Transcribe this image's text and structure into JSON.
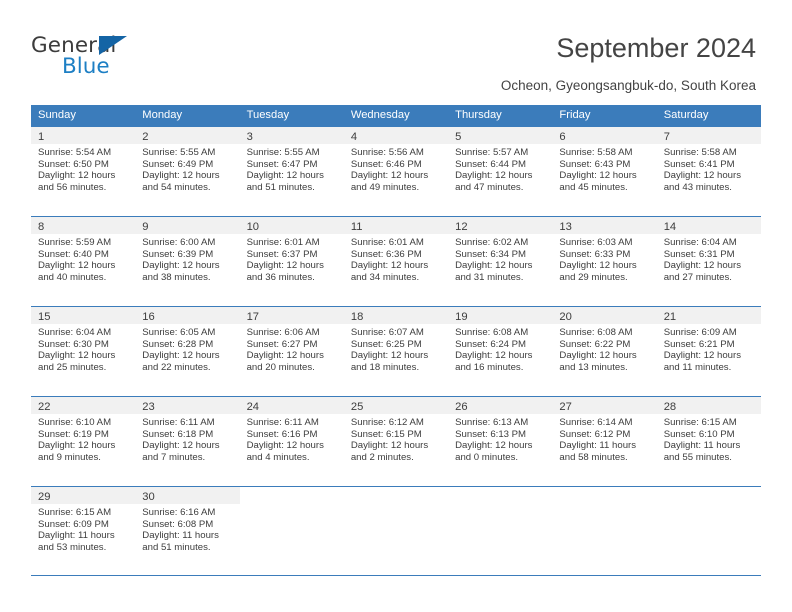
{
  "brand": {
    "name_top": "General",
    "name_bottom": "Blue",
    "triangle_color": "#1464a5",
    "blue_color": "#1d7fc4"
  },
  "header": {
    "title": "September 2024",
    "subtitle": "Ocheon, Gyeongsangbuk-do, South Korea"
  },
  "theme": {
    "header_blue": "#3b7cbb",
    "daynum_band": "#f1f1f1",
    "text": "#3d3d3d"
  },
  "weekdays": [
    "Sunday",
    "Monday",
    "Tuesday",
    "Wednesday",
    "Thursday",
    "Friday",
    "Saturday"
  ],
  "labels": {
    "sunrise_prefix": "Sunrise: ",
    "sunset_prefix": "Sunset: ",
    "daylight_prefix": "Daylight: "
  },
  "weeks": [
    [
      {
        "day": "1",
        "sunrise": "Sunrise: 5:54 AM",
        "sunset": "Sunset: 6:50 PM",
        "daylight_1": "Daylight: 12 hours",
        "daylight_2": "and 56 minutes."
      },
      {
        "day": "2",
        "sunrise": "Sunrise: 5:55 AM",
        "sunset": "Sunset: 6:49 PM",
        "daylight_1": "Daylight: 12 hours",
        "daylight_2": "and 54 minutes."
      },
      {
        "day": "3",
        "sunrise": "Sunrise: 5:55 AM",
        "sunset": "Sunset: 6:47 PM",
        "daylight_1": "Daylight: 12 hours",
        "daylight_2": "and 51 minutes."
      },
      {
        "day": "4",
        "sunrise": "Sunrise: 5:56 AM",
        "sunset": "Sunset: 6:46 PM",
        "daylight_1": "Daylight: 12 hours",
        "daylight_2": "and 49 minutes."
      },
      {
        "day": "5",
        "sunrise": "Sunrise: 5:57 AM",
        "sunset": "Sunset: 6:44 PM",
        "daylight_1": "Daylight: 12 hours",
        "daylight_2": "and 47 minutes."
      },
      {
        "day": "6",
        "sunrise": "Sunrise: 5:58 AM",
        "sunset": "Sunset: 6:43 PM",
        "daylight_1": "Daylight: 12 hours",
        "daylight_2": "and 45 minutes."
      },
      {
        "day": "7",
        "sunrise": "Sunrise: 5:58 AM",
        "sunset": "Sunset: 6:41 PM",
        "daylight_1": "Daylight: 12 hours",
        "daylight_2": "and 43 minutes."
      }
    ],
    [
      {
        "day": "8",
        "sunrise": "Sunrise: 5:59 AM",
        "sunset": "Sunset: 6:40 PM",
        "daylight_1": "Daylight: 12 hours",
        "daylight_2": "and 40 minutes."
      },
      {
        "day": "9",
        "sunrise": "Sunrise: 6:00 AM",
        "sunset": "Sunset: 6:39 PM",
        "daylight_1": "Daylight: 12 hours",
        "daylight_2": "and 38 minutes."
      },
      {
        "day": "10",
        "sunrise": "Sunrise: 6:01 AM",
        "sunset": "Sunset: 6:37 PM",
        "daylight_1": "Daylight: 12 hours",
        "daylight_2": "and 36 minutes."
      },
      {
        "day": "11",
        "sunrise": "Sunrise: 6:01 AM",
        "sunset": "Sunset: 6:36 PM",
        "daylight_1": "Daylight: 12 hours",
        "daylight_2": "and 34 minutes."
      },
      {
        "day": "12",
        "sunrise": "Sunrise: 6:02 AM",
        "sunset": "Sunset: 6:34 PM",
        "daylight_1": "Daylight: 12 hours",
        "daylight_2": "and 31 minutes."
      },
      {
        "day": "13",
        "sunrise": "Sunrise: 6:03 AM",
        "sunset": "Sunset: 6:33 PM",
        "daylight_1": "Daylight: 12 hours",
        "daylight_2": "and 29 minutes."
      },
      {
        "day": "14",
        "sunrise": "Sunrise: 6:04 AM",
        "sunset": "Sunset: 6:31 PM",
        "daylight_1": "Daylight: 12 hours",
        "daylight_2": "and 27 minutes."
      }
    ],
    [
      {
        "day": "15",
        "sunrise": "Sunrise: 6:04 AM",
        "sunset": "Sunset: 6:30 PM",
        "daylight_1": "Daylight: 12 hours",
        "daylight_2": "and 25 minutes."
      },
      {
        "day": "16",
        "sunrise": "Sunrise: 6:05 AM",
        "sunset": "Sunset: 6:28 PM",
        "daylight_1": "Daylight: 12 hours",
        "daylight_2": "and 22 minutes."
      },
      {
        "day": "17",
        "sunrise": "Sunrise: 6:06 AM",
        "sunset": "Sunset: 6:27 PM",
        "daylight_1": "Daylight: 12 hours",
        "daylight_2": "and 20 minutes."
      },
      {
        "day": "18",
        "sunrise": "Sunrise: 6:07 AM",
        "sunset": "Sunset: 6:25 PM",
        "daylight_1": "Daylight: 12 hours",
        "daylight_2": "and 18 minutes."
      },
      {
        "day": "19",
        "sunrise": "Sunrise: 6:08 AM",
        "sunset": "Sunset: 6:24 PM",
        "daylight_1": "Daylight: 12 hours",
        "daylight_2": "and 16 minutes."
      },
      {
        "day": "20",
        "sunrise": "Sunrise: 6:08 AM",
        "sunset": "Sunset: 6:22 PM",
        "daylight_1": "Daylight: 12 hours",
        "daylight_2": "and 13 minutes."
      },
      {
        "day": "21",
        "sunrise": "Sunrise: 6:09 AM",
        "sunset": "Sunset: 6:21 PM",
        "daylight_1": "Daylight: 12 hours",
        "daylight_2": "and 11 minutes."
      }
    ],
    [
      {
        "day": "22",
        "sunrise": "Sunrise: 6:10 AM",
        "sunset": "Sunset: 6:19 PM",
        "daylight_1": "Daylight: 12 hours",
        "daylight_2": "and 9 minutes."
      },
      {
        "day": "23",
        "sunrise": "Sunrise: 6:11 AM",
        "sunset": "Sunset: 6:18 PM",
        "daylight_1": "Daylight: 12 hours",
        "daylight_2": "and 7 minutes."
      },
      {
        "day": "24",
        "sunrise": "Sunrise: 6:11 AM",
        "sunset": "Sunset: 6:16 PM",
        "daylight_1": "Daylight: 12 hours",
        "daylight_2": "and 4 minutes."
      },
      {
        "day": "25",
        "sunrise": "Sunrise: 6:12 AM",
        "sunset": "Sunset: 6:15 PM",
        "daylight_1": "Daylight: 12 hours",
        "daylight_2": "and 2 minutes."
      },
      {
        "day": "26",
        "sunrise": "Sunrise: 6:13 AM",
        "sunset": "Sunset: 6:13 PM",
        "daylight_1": "Daylight: 12 hours",
        "daylight_2": "and 0 minutes."
      },
      {
        "day": "27",
        "sunrise": "Sunrise: 6:14 AM",
        "sunset": "Sunset: 6:12 PM",
        "daylight_1": "Daylight: 11 hours",
        "daylight_2": "and 58 minutes."
      },
      {
        "day": "28",
        "sunrise": "Sunrise: 6:15 AM",
        "sunset": "Sunset: 6:10 PM",
        "daylight_1": "Daylight: 11 hours",
        "daylight_2": "and 55 minutes."
      }
    ],
    [
      {
        "day": "29",
        "sunrise": "Sunrise: 6:15 AM",
        "sunset": "Sunset: 6:09 PM",
        "daylight_1": "Daylight: 11 hours",
        "daylight_2": "and 53 minutes."
      },
      {
        "day": "30",
        "sunrise": "Sunrise: 6:16 AM",
        "sunset": "Sunset: 6:08 PM",
        "daylight_1": "Daylight: 11 hours",
        "daylight_2": "and 51 minutes."
      },
      {
        "day": "",
        "sunrise": "",
        "sunset": "",
        "daylight_1": "",
        "daylight_2": ""
      },
      {
        "day": "",
        "sunrise": "",
        "sunset": "",
        "daylight_1": "",
        "daylight_2": ""
      },
      {
        "day": "",
        "sunrise": "",
        "sunset": "",
        "daylight_1": "",
        "daylight_2": ""
      },
      {
        "day": "",
        "sunrise": "",
        "sunset": "",
        "daylight_1": "",
        "daylight_2": ""
      },
      {
        "day": "",
        "sunrise": "",
        "sunset": "",
        "daylight_1": "",
        "daylight_2": ""
      }
    ]
  ]
}
